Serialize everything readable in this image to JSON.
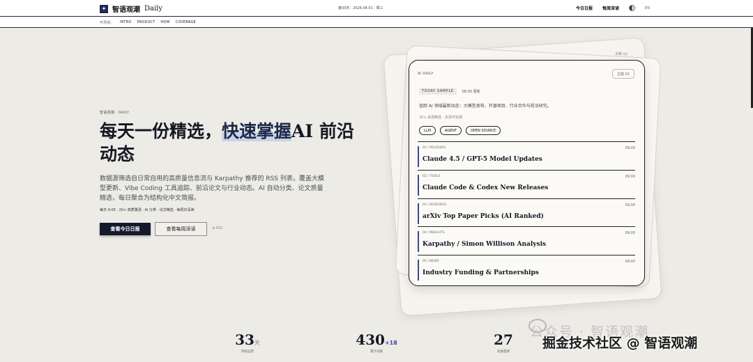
{
  "topbar": {
    "brand_mark": "✦",
    "brand_name": "智语观潮",
    "brand_daily": "Daily",
    "issue": "第33天 · 2026.04.01 · 周三",
    "nav": [
      "今日日报",
      "每周深读"
    ],
    "lang": "EN"
  },
  "subnav": {
    "label": "可导航：",
    "items": [
      "INTRO",
      "PRODUCT",
      "HOW",
      "COVERAGE"
    ]
  },
  "hero": {
    "kicker": "智语观潮 · DAILY",
    "headline_pre": "每天一份精选，",
    "headline_hl": "快速掌握",
    "headline_post": "AI 前沿动态",
    "description": "数据源筛选自日常自用的高质量信息流与 Karpathy 推荐的 RSS 列表，覆盖大模型更新、Vibe Coding 工具追踪、前沿论文与行业动态。AI 自动分类、论文质量精选，每日聚合为结构化中文简报。",
    "meta": "每日 9:00 · 20+ 高质量源 · AI 分类 · 论文精选 · 每周日深读",
    "btn_primary": "查看今日日报",
    "btn_secondary": "查看每周深读",
    "rss": "⊕ RSS"
  },
  "card": {
    "back_tag": "主题 03",
    "header": "AI DAILY",
    "tag": "主题 01",
    "today_chip": "TODAY SAMPLE",
    "today_time": "08:00 更新",
    "desc": "追踪 AI 领域最新动态：大模型发布、开源项目、行业合作与前沿研究。",
    "sub": "20+ 来源精选 · 多源可追溯",
    "tags": [
      "LLM",
      "AGENT",
      "OPEN SOURCE"
    ],
    "items": [
      {
        "cat": "01 / RELEASES",
        "time": "09:00",
        "title": "Claude 4.5 / GPT-5 Model Updates"
      },
      {
        "cat": "02 / TOOLS",
        "time": "09:00",
        "title": "Claude Code & Codex New Releases"
      },
      {
        "cat": "03 / RESEARCH",
        "time": "09:00",
        "title": "arXiv Top Paper Picks (AI Ranked)"
      },
      {
        "cat": "04 / INSIGHTS",
        "time": "09:00",
        "title": "Karpathy / Simon Willison Analysis"
      },
      {
        "cat": "05 / NEWS",
        "time": "09:00",
        "title": "Industry Funding & Partnerships"
      }
    ]
  },
  "stats": [
    {
      "num": "33",
      "unit": "天",
      "plus": "",
      "label": "持续运营"
    },
    {
      "num": "430",
      "unit": "",
      "plus": "+18",
      "label": "累计日报"
    },
    {
      "num": "27",
      "unit": "",
      "plus": "",
      "label": "高质量源"
    }
  ],
  "watermark": {
    "line1": "公众号 · 智语观潮",
    "line2": "掘金技术社区 @ 智语观潮"
  }
}
